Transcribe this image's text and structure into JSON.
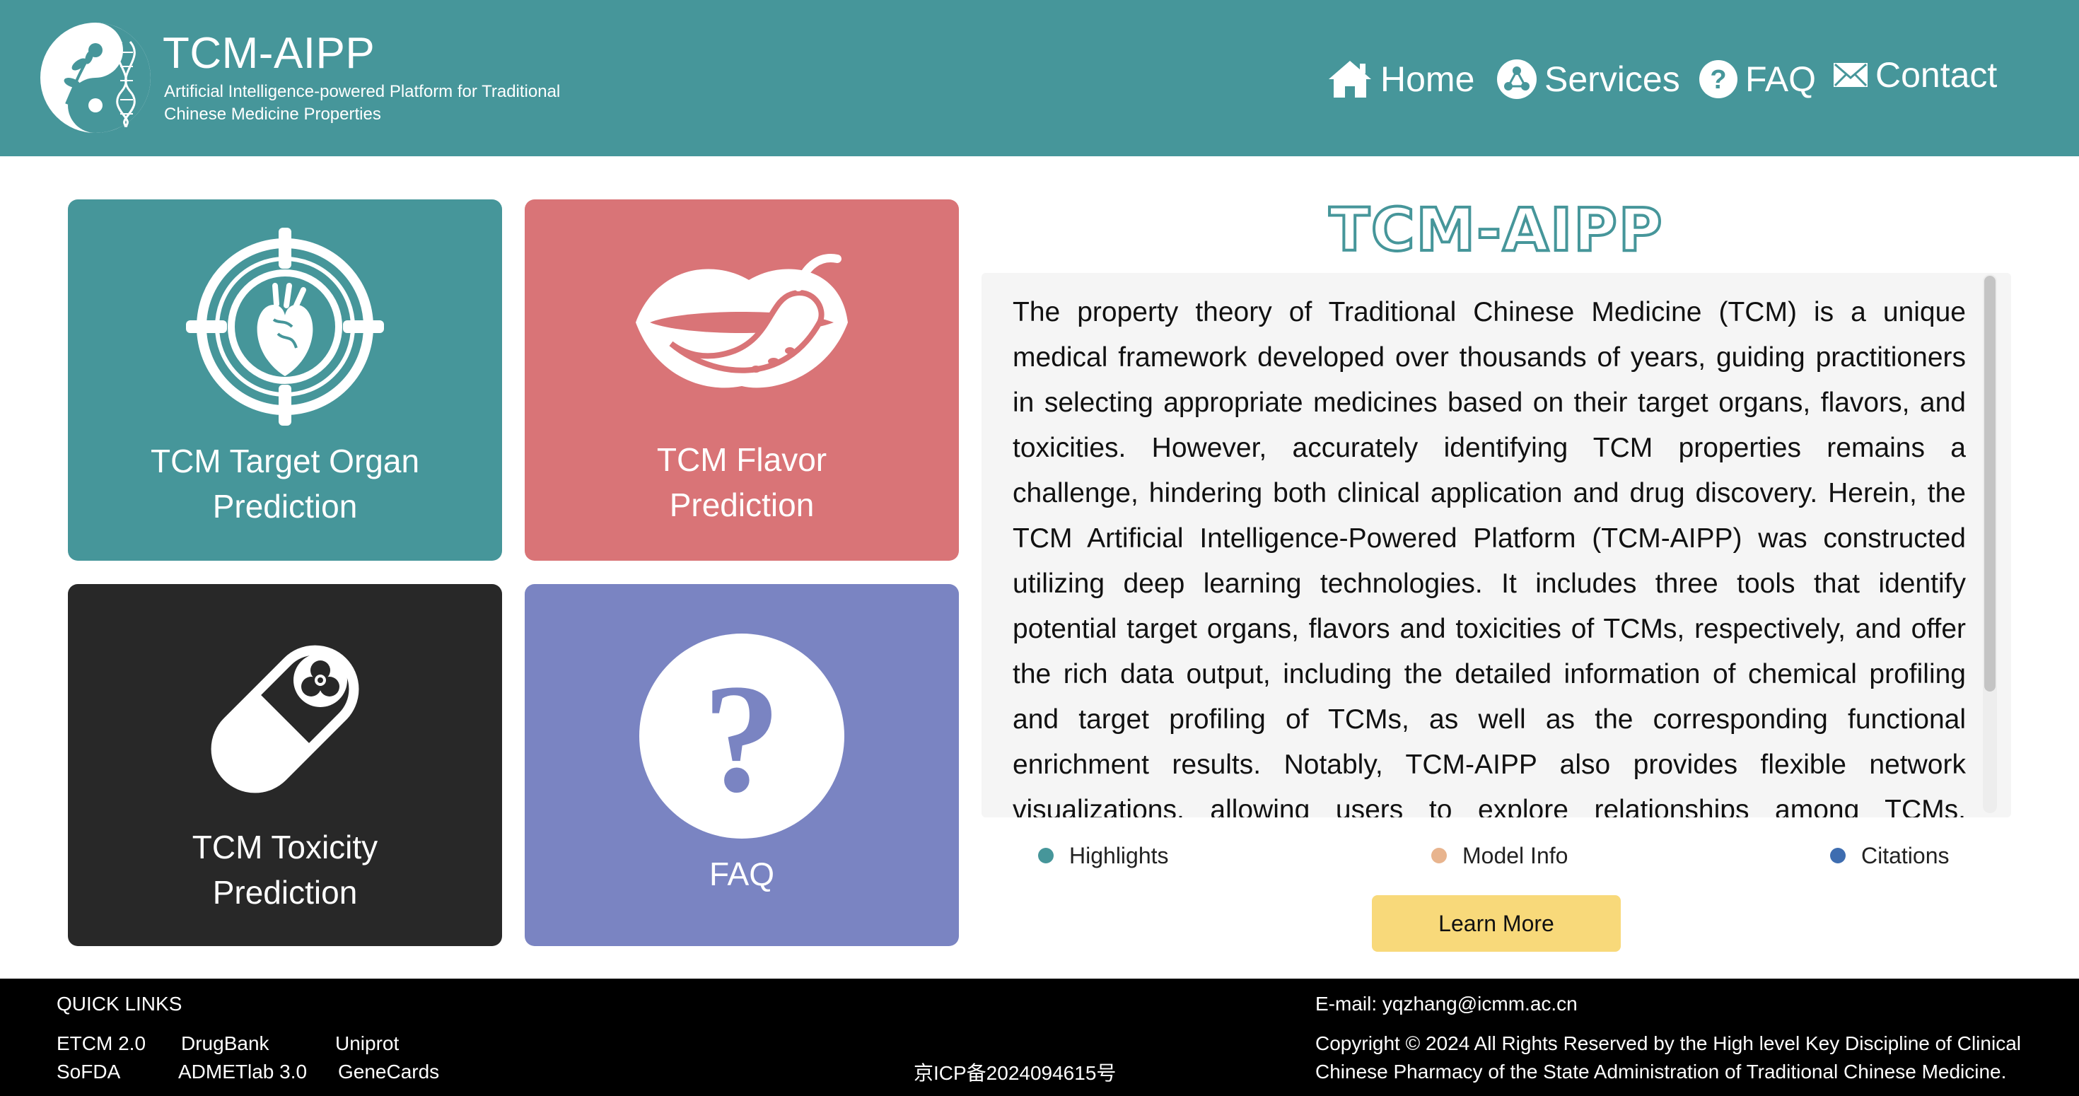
{
  "header": {
    "title": "TCM-AIPP",
    "subtitle_line1": "Artificial Intelligence-powered Platform for Traditional",
    "subtitle_line2": "Chinese Medicine Properties",
    "nav": [
      {
        "label": "Home",
        "icon": "home-icon"
      },
      {
        "label": "Services",
        "icon": "network-icon"
      },
      {
        "label": "FAQ",
        "icon": "question-circle-icon"
      },
      {
        "label": "Contact",
        "icon": "envelope-icon"
      }
    ]
  },
  "tiles": [
    {
      "label_line1": "TCM Target Organ",
      "label_line2": "Prediction",
      "icon": "heart-target-icon",
      "color": "#46969a"
    },
    {
      "label_line1": "TCM Flavor",
      "label_line2": "Prediction",
      "icon": "lips-chili-icon",
      "color": "#d97477"
    },
    {
      "label_line1": "TCM Toxicity",
      "label_line2": "Prediction",
      "icon": "biohazard-pill-icon",
      "color": "#282828"
    },
    {
      "label_line1": "FAQ",
      "label_line2": "",
      "icon": "question-circle-icon",
      "color": "#7a84c2"
    }
  ],
  "intro": {
    "logo_text": "TCM-AIPP",
    "text": "The property theory of Traditional Chinese Medicine (TCM) is a unique medical framework developed over thousands of years, guiding practitioners in selecting appropriate medicines based on their target organs, flavors, and toxicities. However, accurately identifying TCM properties remains a challenge, hindering both clinical application and drug discovery. Herein, the TCM Artificial Intelligence-Powered Platform (TCM-AIPP) was constructed utilizing deep learning technologies. It includes three tools that identify potential target organs, flavors and toxicities of TCMs, respectively, and offer the rich data output, including the detailed information of chemical profiling and target profiling of TCMs, as well as the corresponding functional enrichment results. Notably, TCM-AIPP also provides flexible network visualizations, allowing users to explore relationships among TCMs, compounds, targets"
  },
  "tabs": [
    {
      "label": "Highlights",
      "color": "#46969a"
    },
    {
      "label": "Model Info",
      "color": "#e8b48e"
    },
    {
      "label": "Citations",
      "color": "#3e6db0"
    }
  ],
  "learn_more_label": "Learn More",
  "footer": {
    "quick_links_title": "QUICK LINKS",
    "links_row1": [
      "ETCM 2.0",
      "DrugBank",
      "Uniprot"
    ],
    "links_row2": [
      "SoFDA",
      "ADMETlab 3.0",
      "GeneCards"
    ],
    "icp": "京ICP备2024094615号",
    "email": "E-mail: yqzhang@icmm.ac.cn",
    "copyright_line1": "Copyright © 2024 All Rights Reserved by the High level Key Discipline of Clinical",
    "copyright_line2": "Chinese Pharmacy of the State Administration of Traditional Chinese Medicine."
  }
}
